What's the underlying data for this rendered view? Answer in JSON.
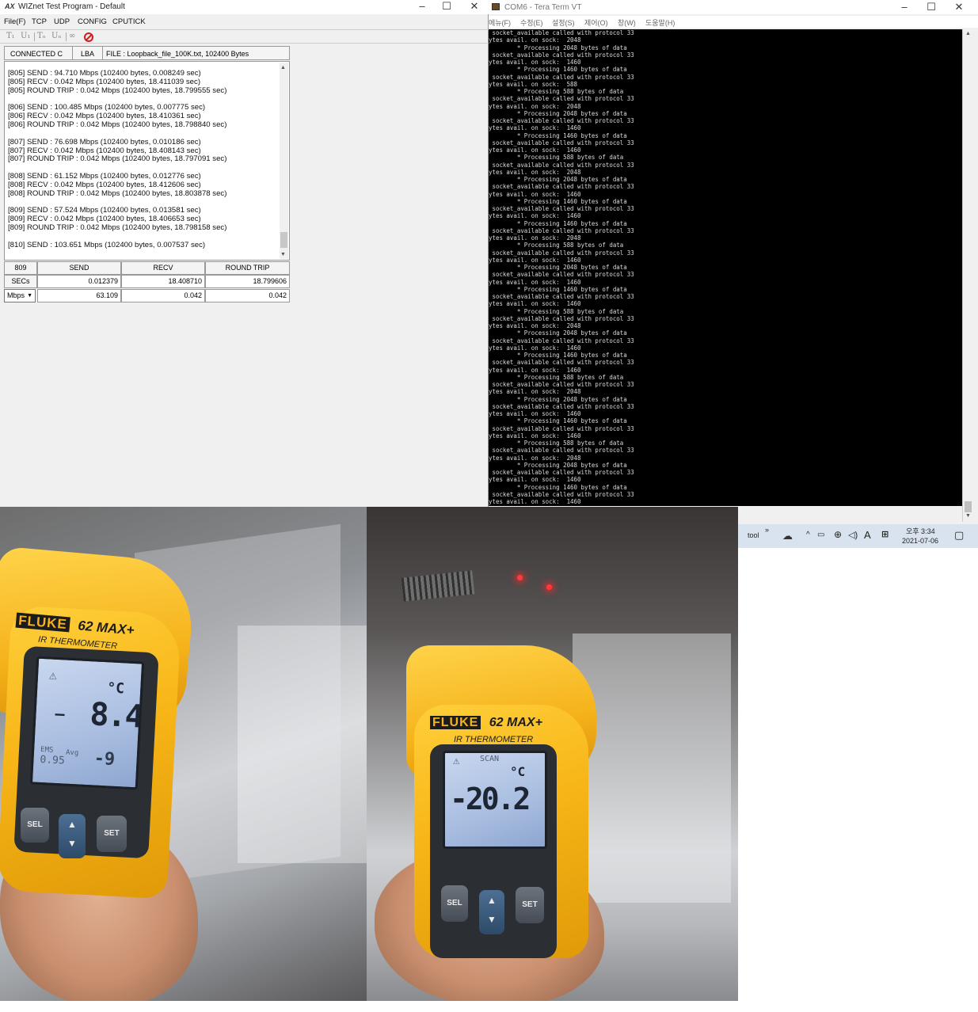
{
  "wiznet": {
    "title": "WIZnet Test Program - Default",
    "app_icon": "AX",
    "menu": [
      "File(F)",
      "TCP",
      "UDP",
      "CONFIG",
      "CPUTICK"
    ],
    "status": {
      "connection": "CONNECTED C",
      "mode": "LBA",
      "file": "FILE : Loopback_file_100K.txt,  102400 Bytes"
    },
    "log": [
      [
        "[805] SEND : 94.710 Mbps (102400 bytes, 0.008249 sec)",
        "[805] RECV : 0.042 Mbps (102400 bytes, 18.411039 sec)",
        "[805] ROUND TRIP : 0.042 Mbps (102400 bytes, 18.799555 sec)"
      ],
      [
        "[806] SEND : 100.485 Mbps (102400 bytes, 0.007775 sec)",
        "[806] RECV : 0.042 Mbps (102400 bytes, 18.410361 sec)",
        "[806] ROUND TRIP : 0.042 Mbps (102400 bytes, 18.798840 sec)"
      ],
      [
        "[807] SEND : 76.698 Mbps (102400 bytes, 0.010186 sec)",
        "[807] RECV : 0.042 Mbps (102400 bytes, 18.408143 sec)",
        "[807] ROUND TRIP : 0.042 Mbps (102400 bytes, 18.797091 sec)"
      ],
      [
        "[808] SEND : 61.152 Mbps (102400 bytes, 0.012776 sec)",
        "[808] RECV : 0.042 Mbps (102400 bytes, 18.412606 sec)",
        "[808] ROUND TRIP : 0.042 Mbps (102400 bytes, 18.803878 sec)"
      ],
      [
        "[809] SEND : 57.524 Mbps (102400 bytes, 0.013581 sec)",
        "[809] RECV : 0.042 Mbps (102400 bytes, 18.406653 sec)",
        "[809] ROUND TRIP : 0.042 Mbps (102400 bytes, 18.798158 sec)"
      ],
      [
        "[810] SEND : 103.651 Mbps (102400 bytes, 0.007537 sec)"
      ]
    ],
    "stats": {
      "count": "809",
      "headers": [
        "SEND",
        "RECV",
        "ROUND TRIP"
      ],
      "secs_label": "SECs",
      "secs": [
        "0.012379",
        "18.408710",
        "18.799606"
      ],
      "unit_select": "Mbps",
      "mbps": [
        "63.109",
        "0.042",
        "0.042"
      ]
    }
  },
  "teraterm": {
    "title": "COM6 - Tera Term VT",
    "menu": [
      "메뉴(F)",
      "수정(E)",
      "설정(S)",
      "제어(O)",
      "창(W)",
      "도움말(H)"
    ],
    "terminal_lines": [
      " socket_available called with protocol 33",
      "ytes avail. on sock:  2048",
      "        * Processing 2048 bytes of data",
      " socket_available called with protocol 33",
      "ytes avail. on sock:  1460",
      "        * Processing 1460 bytes of data",
      " socket_available called with protocol 33",
      "ytes avail. on sock:  588",
      "        * Processing 588 bytes of data",
      " socket_available called with protocol 33",
      "ytes avail. on sock:  2048",
      "        * Processing 2048 bytes of data",
      " socket_available called with protocol 33",
      "ytes avail. on sock:  1460",
      "        * Processing 1460 bytes of data",
      " socket_available called with protocol 33",
      "ytes avail. on sock:  1460",
      "        * Processing 588 bytes of data",
      " socket_available called with protocol 33",
      "ytes avail. on sock:  2048",
      "        * Processing 2048 bytes of data",
      " socket_available called with protocol 33",
      "ytes avail. on sock:  1460",
      "        * Processing 1460 bytes of data",
      " socket_available called with protocol 33",
      "ytes avail. on sock:  1460",
      "        * Processing 1460 bytes of data",
      " socket_available called with protocol 33",
      "ytes avail. on sock:  2048",
      "        * Processing 588 bytes of data",
      " socket_available called with protocol 33",
      "ytes avail. on sock:  1460",
      "        * Processing 2048 bytes of data",
      " socket_available called with protocol 33",
      "ytes avail. on sock:  1460",
      "        * Processing 1460 bytes of data",
      " socket_available called with protocol 33",
      "ytes avail. on sock:  1460",
      "        * Processing 588 bytes of data",
      " socket_available called with protocol 33",
      "ytes avail. on sock:  2048",
      "        * Processing 2048 bytes of data",
      " socket_available called with protocol 33",
      "ytes avail. on sock:  1460",
      "        * Processing 1460 bytes of data",
      " socket_available called with protocol 33",
      "ytes avail. on sock:  1460",
      "        * Processing 588 bytes of data",
      " socket_available called with protocol 33",
      "ytes avail. on sock:  2048",
      "        * Processing 2048 bytes of data",
      " socket_available called with protocol 33",
      "ytes avail. on sock:  1460",
      "        * Processing 1460 bytes of data",
      " socket_available called with protocol 33",
      "ytes avail. on sock:  1460",
      "        * Processing 588 bytes of data",
      " socket_available called with protocol 33",
      "ytes avail. on sock:  2048",
      "        * Processing 2048 bytes of data",
      " socket_available called with protocol 33",
      "ytes avail. on sock:  1460",
      "        * Processing 1460 bytes of data",
      " socket_available called with protocol 33",
      "ytes avail. on sock:  1460",
      "        * Processing 588 bytes of data",
      " socket_available called with protocol 33",
      "ytes avail. on sock:  2048"
    ]
  },
  "taskbar": {
    "tool_label": "tool",
    "ime": "A",
    "time": "오후 3:34",
    "date": "2021-07-06"
  },
  "photos": {
    "left": {
      "brand": "FLUKE",
      "model": "62 MAX+",
      "subtitle": "IR THERMOMETER",
      "unit": "°C",
      "reading": "8.4",
      "emis_label": "EMS",
      "emis_value": "0.95",
      "avg_label": "Avg",
      "secondary": "-9",
      "btn_sel": "SEL",
      "btn_set": "SET"
    },
    "right": {
      "brand": "FLUKE",
      "model": "62 MAX+",
      "subtitle": "IR THERMOMETER",
      "scan_label": "SCAN",
      "unit": "°C",
      "reading": "-20.2",
      "btn_sel": "SEL",
      "btn_set": "SET"
    }
  }
}
